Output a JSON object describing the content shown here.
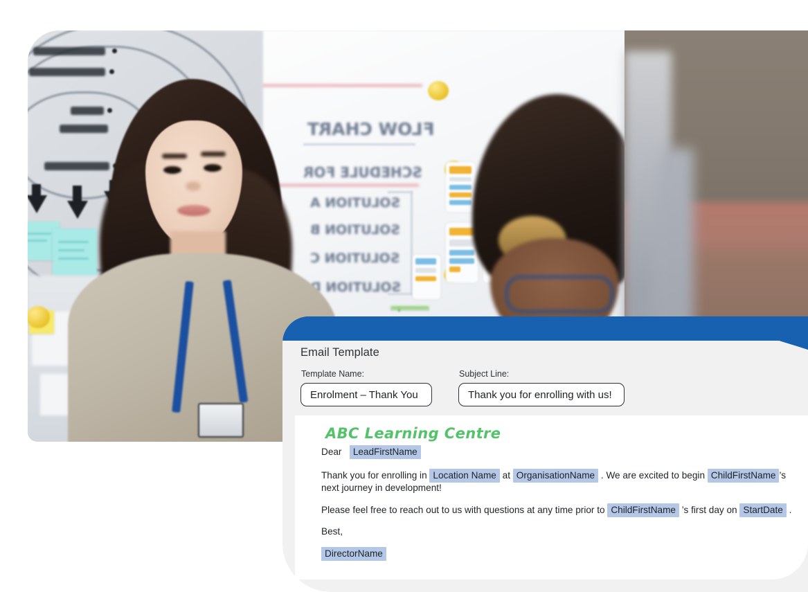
{
  "panel": {
    "title": "Email Template",
    "fields": {
      "template_name_label": "Template Name:",
      "template_name_value": "Enrolment – Thank You",
      "subject_label": "Subject Line:",
      "subject_value": "Thank you for enrolling with us!"
    },
    "accent_color": "#1761b0",
    "surface_color": "#f1f1f1",
    "body_color": "#ffffff"
  },
  "email": {
    "heading": "ABC Learning Centre",
    "heading_color": "#53c36a",
    "merge_field_color": "#b4c7e7",
    "greeting_prefix": "Dear",
    "greeting_field": "LeadFirstName",
    "p1": {
      "a": "Thank you for enrolling in",
      "field1": "Location Name",
      "b": "at",
      "field2": "OrganisationName",
      "c": ".  We are excited to begin",
      "field3": "ChildFirstName",
      "d": "’s",
      "e": "next journey in development!"
    },
    "p2": {
      "a": "Please feel free to reach out to us with questions at any time prior to",
      "field1": "ChildFirstName",
      "b": "’s  first day on",
      "field2": "StartDate",
      "c": "."
    },
    "signoff": "Best,",
    "signature_field": "DirectorName"
  },
  "photo": {
    "alt": "Two colleagues collaborating in front of a whiteboard covered in flow-chart sketches and app wireframes",
    "whiteboard_text": [
      "FLOW CHART",
      "SCHEDULE FOR",
      "SOLUTION A",
      "SOLUTION B",
      "SOLUTION C",
      "SOLUTION D"
    ]
  }
}
